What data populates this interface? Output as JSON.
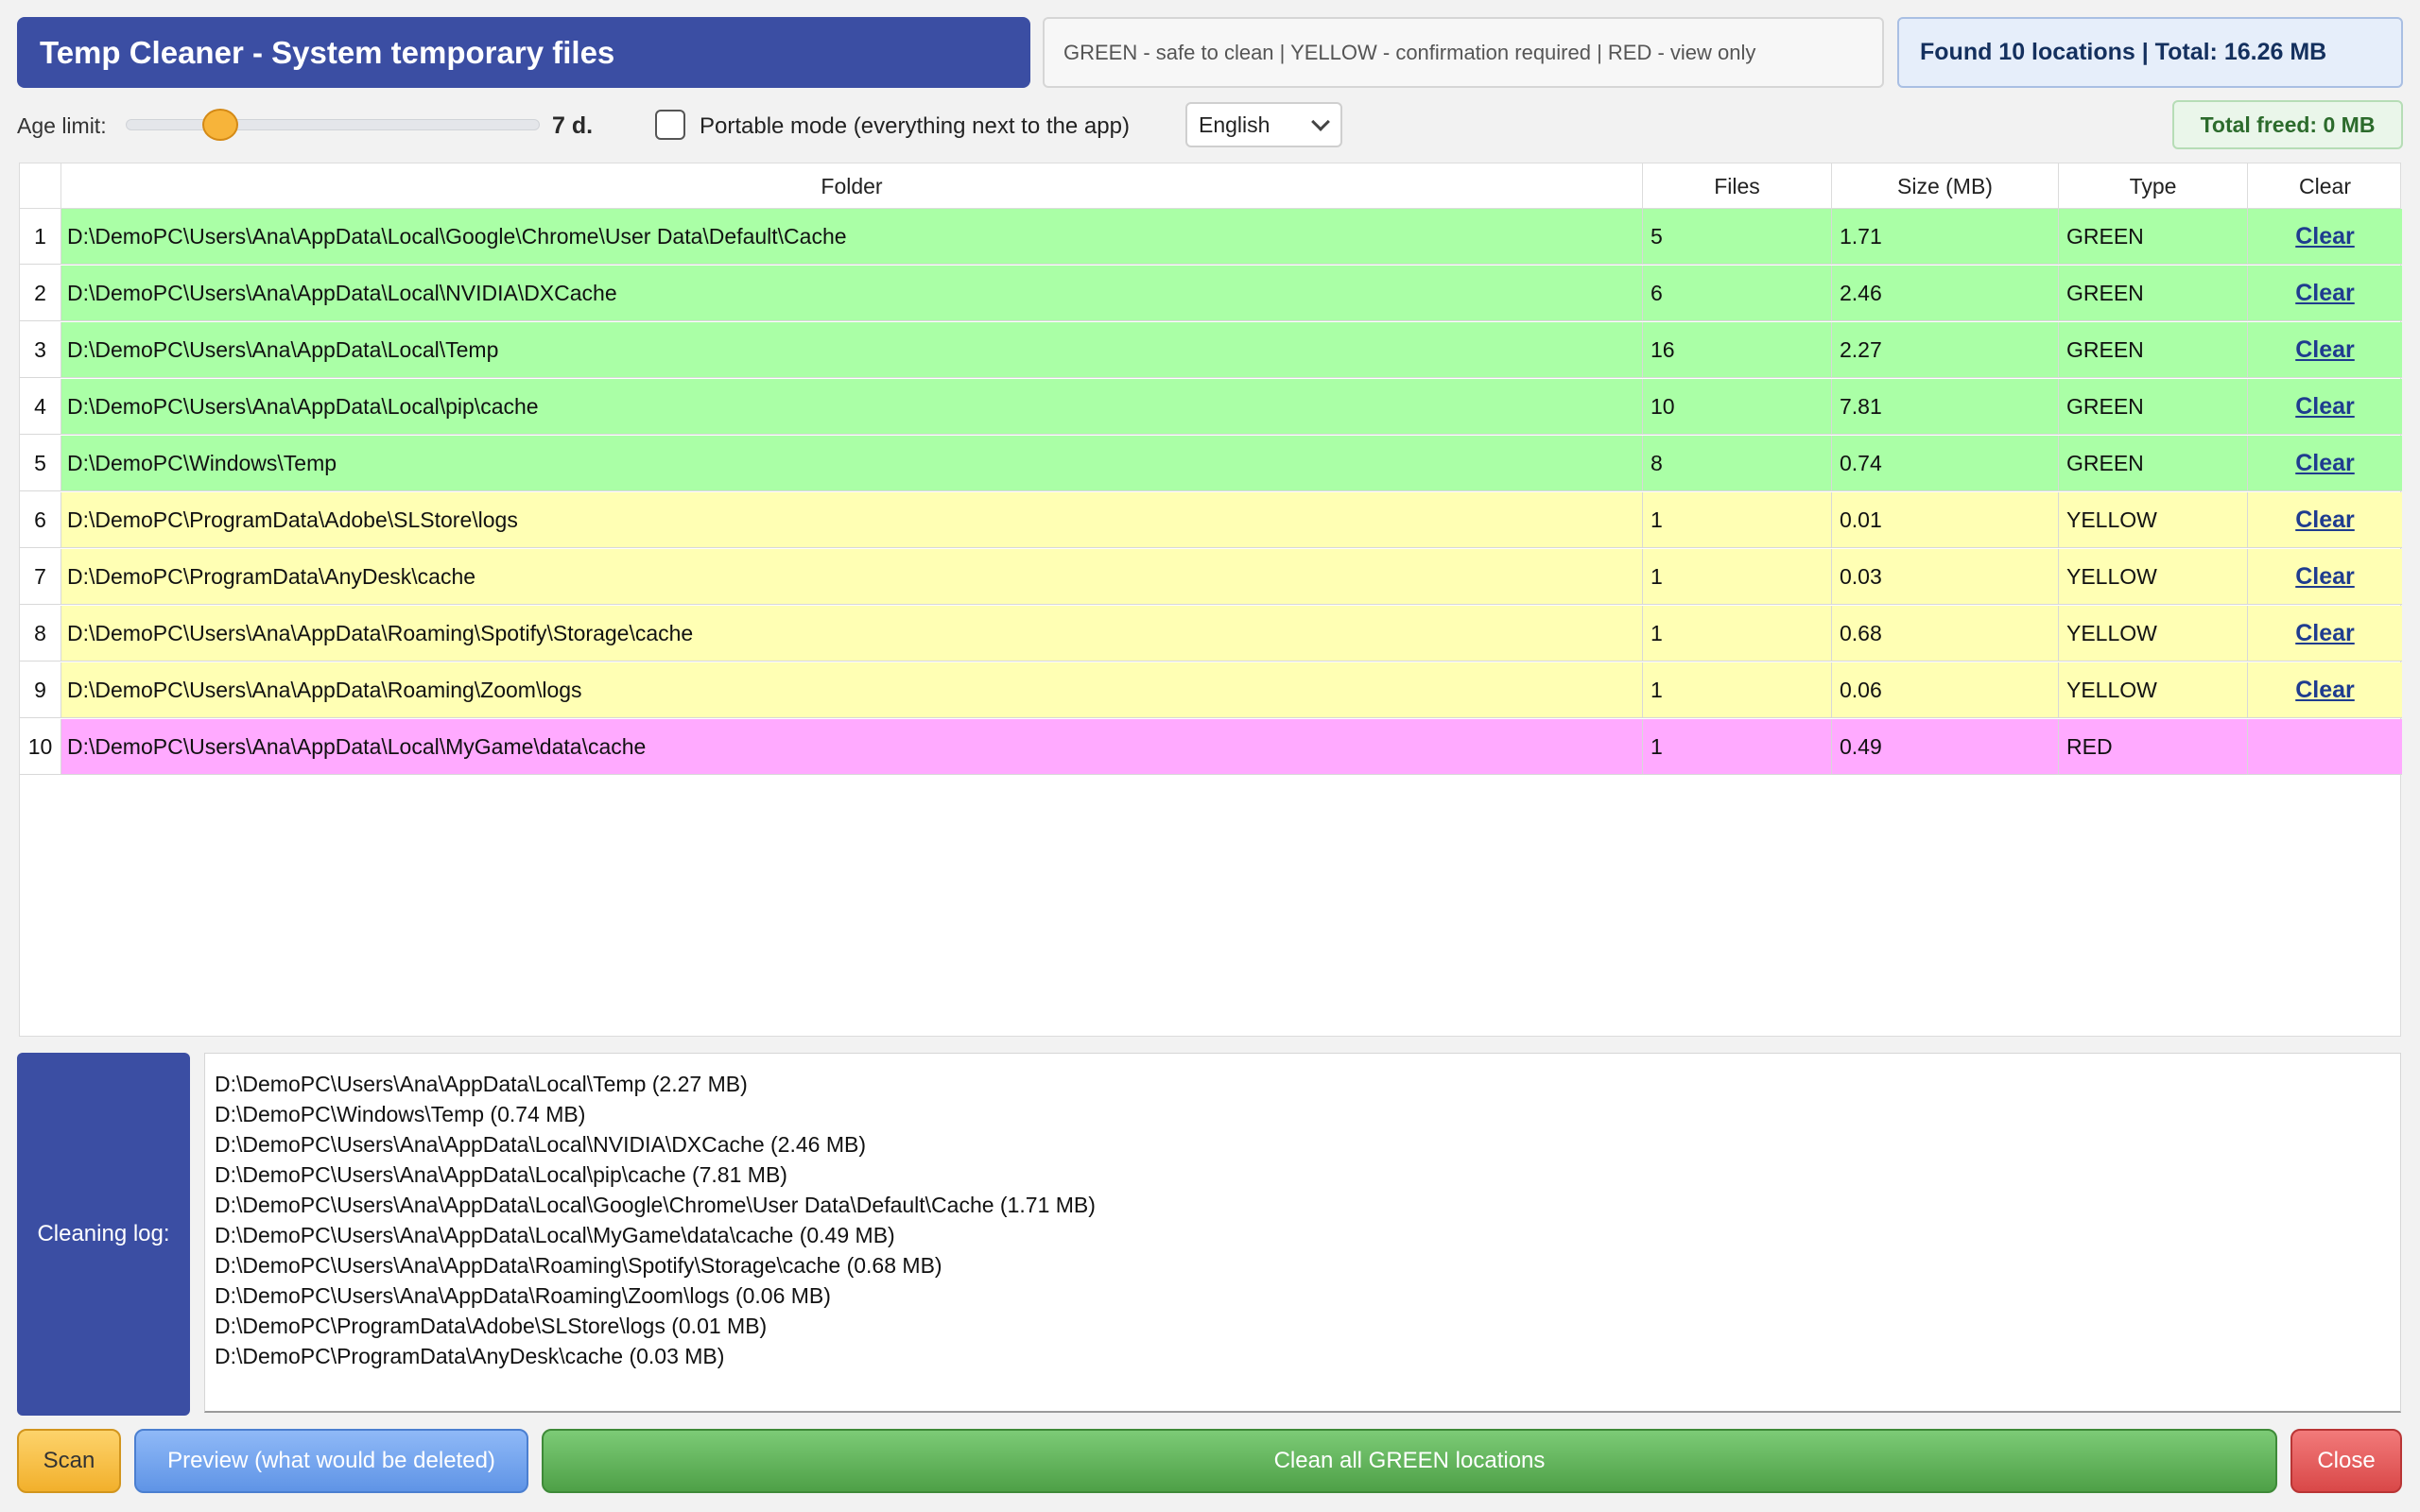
{
  "header": {
    "title": "Temp Cleaner - System temporary files",
    "legend": "GREEN - safe to clean | YELLOW - confirmation required | RED - view only",
    "summary": "Found 10 locations | Total: 16.26 MB"
  },
  "controls": {
    "age_label": "Age limit:",
    "age_value": "7 d.",
    "age_days": 7,
    "portable_label": "Portable mode (everything next to the app)",
    "portable_checked": false,
    "language": "English",
    "total_freed": "Total freed: 0 MB"
  },
  "table": {
    "columns": [
      "Folder",
      "Files",
      "Size (MB)",
      "Type",
      "Clear"
    ],
    "rows": [
      {
        "n": "1",
        "folder": "D:\\DemoPC\\Users\\Ana\\AppData\\Local\\Google\\Chrome\\User Data\\Default\\Cache",
        "files": "5",
        "size": "1.71",
        "type": "GREEN",
        "clear": "Clear"
      },
      {
        "n": "2",
        "folder": "D:\\DemoPC\\Users\\Ana\\AppData\\Local\\NVIDIA\\DXCache",
        "files": "6",
        "size": "2.46",
        "type": "GREEN",
        "clear": "Clear"
      },
      {
        "n": "3",
        "folder": "D:\\DemoPC\\Users\\Ana\\AppData\\Local\\Temp",
        "files": "16",
        "size": "2.27",
        "type": "GREEN",
        "clear": "Clear"
      },
      {
        "n": "4",
        "folder": "D:\\DemoPC\\Users\\Ana\\AppData\\Local\\pip\\cache",
        "files": "10",
        "size": "7.81",
        "type": "GREEN",
        "clear": "Clear"
      },
      {
        "n": "5",
        "folder": "D:\\DemoPC\\Windows\\Temp",
        "files": "8",
        "size": "0.74",
        "type": "GREEN",
        "clear": "Clear"
      },
      {
        "n": "6",
        "folder": "D:\\DemoPC\\ProgramData\\Adobe\\SLStore\\logs",
        "files": "1",
        "size": "0.01",
        "type": "YELLOW",
        "clear": "Clear"
      },
      {
        "n": "7",
        "folder": "D:\\DemoPC\\ProgramData\\AnyDesk\\cache",
        "files": "1",
        "size": "0.03",
        "type": "YELLOW",
        "clear": "Clear"
      },
      {
        "n": "8",
        "folder": "D:\\DemoPC\\Users\\Ana\\AppData\\Roaming\\Spotify\\Storage\\cache",
        "files": "1",
        "size": "0.68",
        "type": "YELLOW",
        "clear": "Clear"
      },
      {
        "n": "9",
        "folder": "D:\\DemoPC\\Users\\Ana\\AppData\\Roaming\\Zoom\\logs",
        "files": "1",
        "size": "0.06",
        "type": "YELLOW",
        "clear": "Clear"
      },
      {
        "n": "10",
        "folder": "D:\\DemoPC\\Users\\Ana\\AppData\\Local\\MyGame\\data\\cache",
        "files": "1",
        "size": "0.49",
        "type": "RED",
        "clear": ""
      }
    ]
  },
  "log": {
    "label": "Cleaning log:",
    "lines": [
      "D:\\DemoPC\\Users\\Ana\\AppData\\Local\\Temp (2.27 MB)",
      "D:\\DemoPC\\Windows\\Temp (0.74 MB)",
      "D:\\DemoPC\\Users\\Ana\\AppData\\Local\\NVIDIA\\DXCache (2.46 MB)",
      "D:\\DemoPC\\Users\\Ana\\AppData\\Local\\pip\\cache (7.81 MB)",
      "D:\\DemoPC\\Users\\Ana\\AppData\\Local\\Google\\Chrome\\User Data\\Default\\Cache (1.71 MB)",
      "D:\\DemoPC\\Users\\Ana\\AppData\\Local\\MyGame\\data\\cache (0.49 MB)",
      "D:\\DemoPC\\Users\\Ana\\AppData\\Roaming\\Spotify\\Storage\\cache (0.68 MB)",
      "D:\\DemoPC\\Users\\Ana\\AppData\\Roaming\\Zoom\\logs (0.06 MB)",
      "D:\\DemoPC\\ProgramData\\Adobe\\SLStore\\logs (0.01 MB)",
      "D:\\DemoPC\\ProgramData\\AnyDesk\\cache (0.03 MB)"
    ]
  },
  "buttons": {
    "scan": "Scan",
    "preview": "Preview (what would be deleted)",
    "clean_green": "Clean all GREEN locations",
    "close": "Close"
  },
  "colors": {
    "accent": "#3b4ea3",
    "green_row": "#aaffa6",
    "yellow_row": "#ffffb4",
    "red_row": "#ffaaff"
  }
}
